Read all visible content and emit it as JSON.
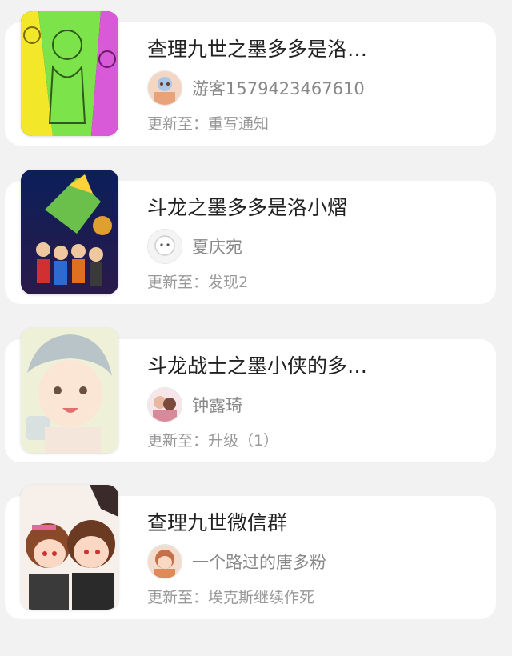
{
  "items": [
    {
      "title": "查理九世之墨多多是洛…",
      "author": "游客1579423467610",
      "update_prefix": "更新至：",
      "update_chapter": "重写通知",
      "cover_icon": "anime-cover-image",
      "avatar_icon": "user-avatar-image"
    },
    {
      "title": "斗龙之墨多多是洛小熠",
      "author": "夏庆宛",
      "update_prefix": "更新至：",
      "update_chapter": "发现2",
      "cover_icon": "anime-cover-image",
      "avatar_icon": "user-avatar-image"
    },
    {
      "title": "斗龙战士之墨小侠的多…",
      "author": "钟露琦",
      "update_prefix": "更新至：",
      "update_chapter": "升级（1）",
      "cover_icon": "anime-cover-image",
      "avatar_icon": "user-avatar-image"
    },
    {
      "title": "查理九世微信群",
      "author": "一个路过的唐多粉",
      "update_prefix": "更新至：",
      "update_chapter": "埃克斯继续作死",
      "cover_icon": "anime-cover-image",
      "avatar_icon": "user-avatar-image"
    }
  ]
}
